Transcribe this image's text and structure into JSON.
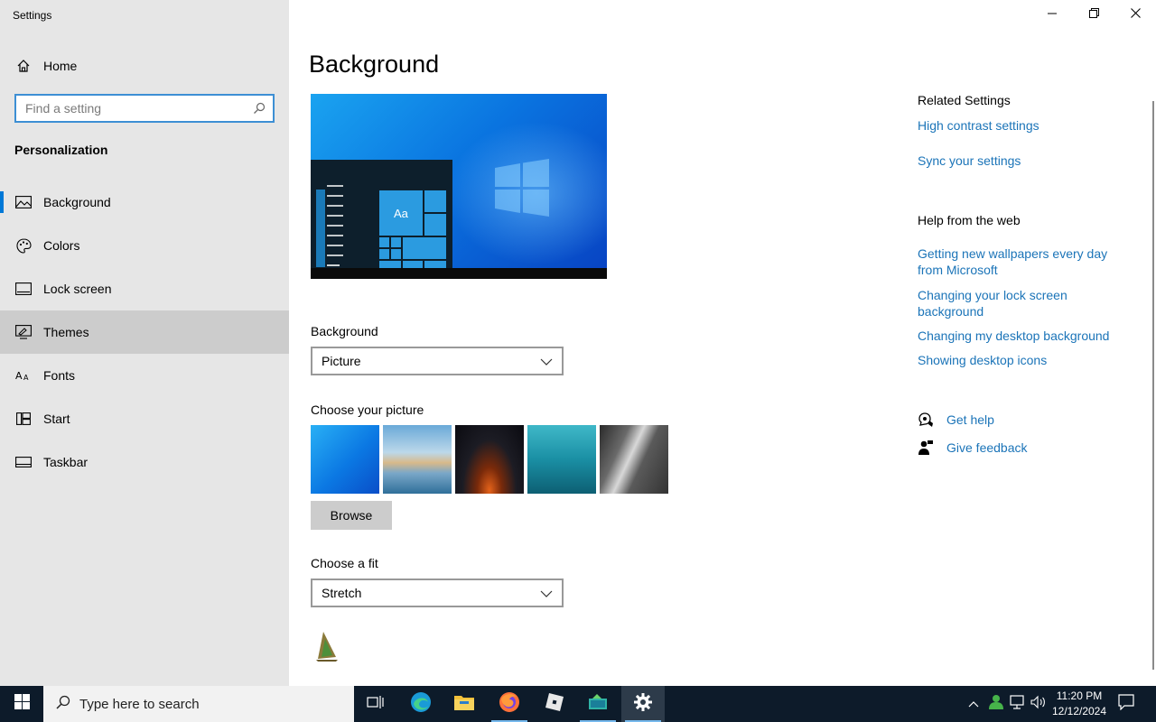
{
  "app": {
    "title": "Settings"
  },
  "sidebar": {
    "home_label": "Home",
    "search_placeholder": "Find a setting",
    "section_title": "Personalization",
    "items": [
      {
        "label": "Background",
        "icon": "picture-icon"
      },
      {
        "label": "Colors",
        "icon": "palette-icon"
      },
      {
        "label": "Lock screen",
        "icon": "lock-screen-icon"
      },
      {
        "label": "Themes",
        "icon": "themes-icon"
      },
      {
        "label": "Fonts",
        "icon": "fonts-icon"
      },
      {
        "label": "Start",
        "icon": "start-icon"
      },
      {
        "label": "Taskbar",
        "icon": "taskbar-icon"
      }
    ],
    "selected": "Background",
    "hovered": "Themes"
  },
  "main": {
    "title": "Background",
    "preview_tile_text": "Aa",
    "background_label": "Background",
    "background_value": "Picture",
    "choose_picture_label": "Choose your picture",
    "browse_label": "Browse",
    "choose_fit_label": "Choose a fit",
    "fit_value": "Stretch"
  },
  "related": {
    "heading": "Related Settings",
    "links": [
      "High contrast settings",
      "Sync your settings"
    ],
    "help_heading": "Help from the web",
    "help_links": [
      "Getting new wallpapers every day from Microsoft",
      "Changing your lock screen background",
      "Changing my desktop background",
      "Showing desktop icons"
    ],
    "get_help": "Get help",
    "give_feedback": "Give feedback"
  },
  "taskbar": {
    "search_placeholder": "Type here to search",
    "time": "11:20 PM",
    "date": "12/12/2024"
  },
  "colors": {
    "accent": "#0078d7",
    "link": "#1b74b8",
    "sidebar_bg": "#e6e6e6",
    "taskbar_bg": "#0d1b2a"
  }
}
